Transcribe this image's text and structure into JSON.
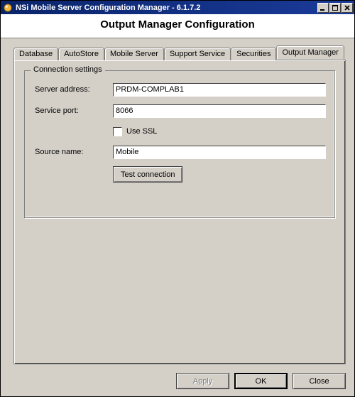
{
  "window": {
    "title": "NSi Mobile Server Configuration Manager - 6.1.7.2"
  },
  "header": {
    "title": "Output Manager Configuration"
  },
  "tabs": {
    "database": "Database",
    "autostore": "AutoStore",
    "mobile_server": "Mobile Server",
    "support_service": "Support Service",
    "securities": "Securities",
    "output_manager": "Output Manager",
    "active": "output_manager"
  },
  "group": {
    "legend": "Connection settings",
    "server_address": {
      "label": "Server address:",
      "value": "PRDM-COMPLAB1"
    },
    "service_port": {
      "label": "Service port:",
      "value": "8066"
    },
    "use_ssl": {
      "label": "Use SSL",
      "checked": false
    },
    "source_name": {
      "label": "Source name:",
      "value": "Mobile"
    },
    "test_button": "Test connection"
  },
  "buttons": {
    "apply": "Apply",
    "ok": "OK",
    "close": "Close"
  }
}
